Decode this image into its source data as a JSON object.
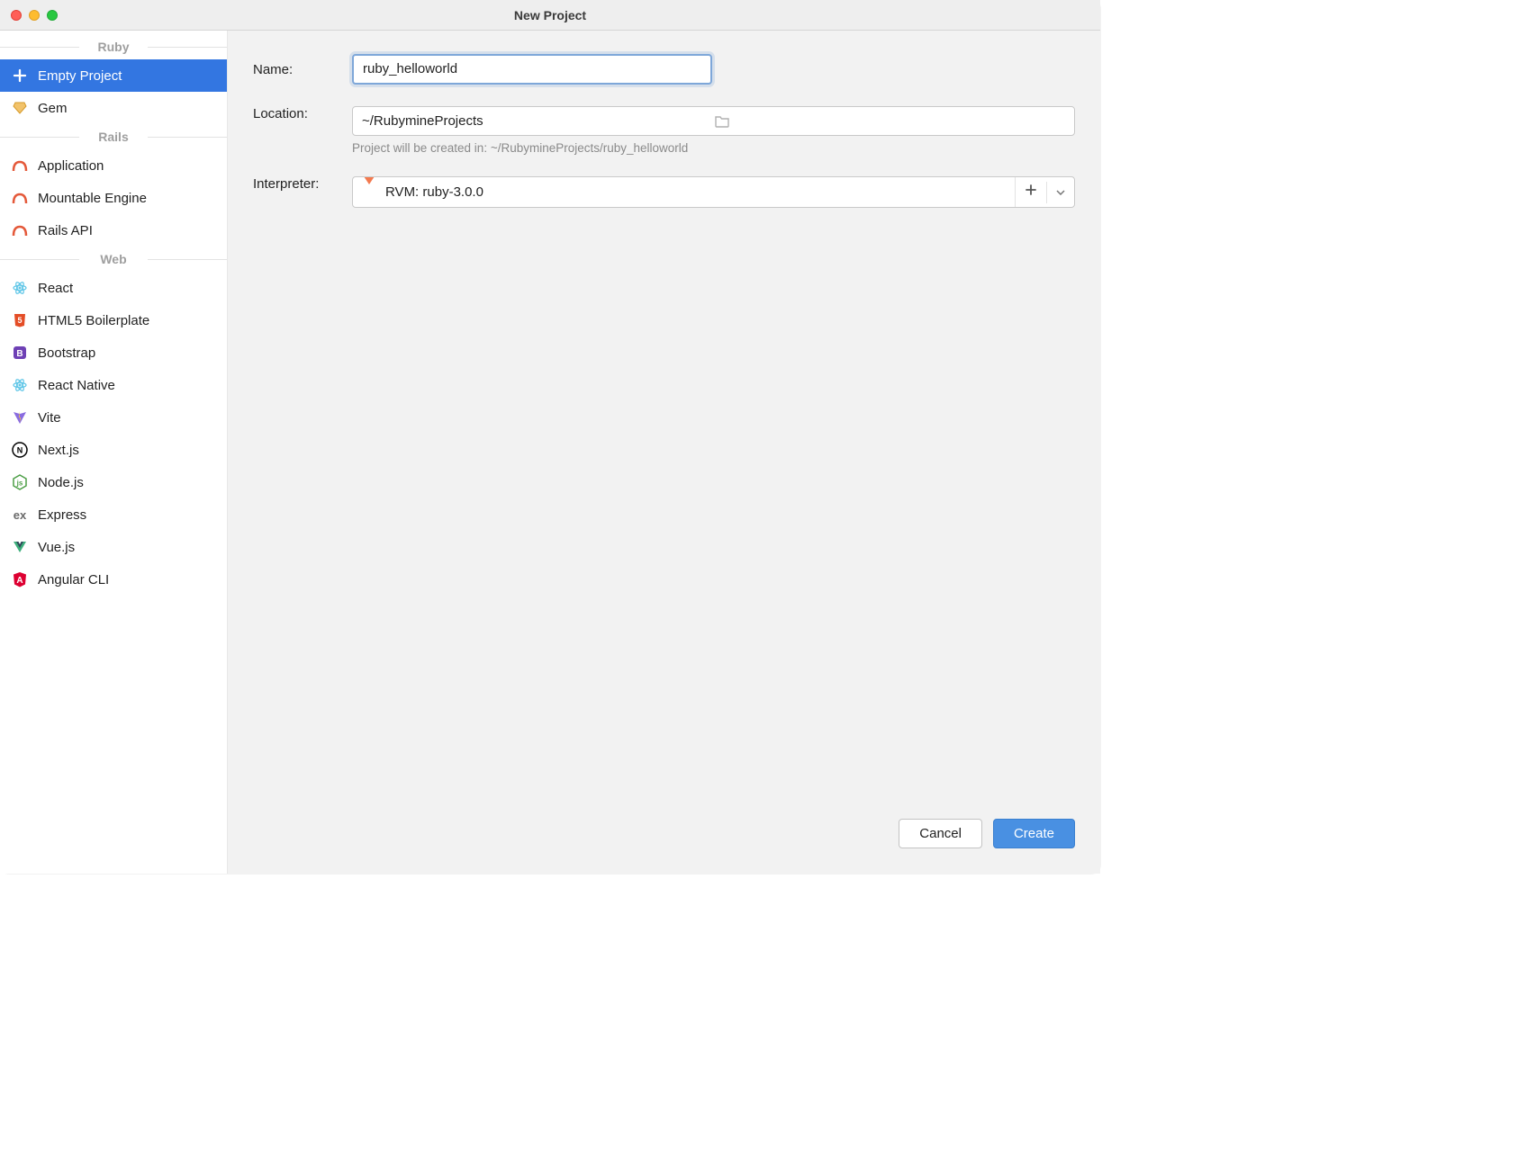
{
  "window": {
    "title": "New Project"
  },
  "sidebar": {
    "categories": [
      {
        "label": "Ruby",
        "items": [
          {
            "label": "Empty Project",
            "icon": "plus-icon",
            "selected": true
          },
          {
            "label": "Gem",
            "icon": "gem-icon"
          }
        ]
      },
      {
        "label": "Rails",
        "items": [
          {
            "label": "Application",
            "icon": "rails-icon"
          },
          {
            "label": "Mountable Engine",
            "icon": "rails-icon"
          },
          {
            "label": "Rails API",
            "icon": "rails-icon"
          }
        ]
      },
      {
        "label": "Web",
        "items": [
          {
            "label": "React",
            "icon": "react-icon"
          },
          {
            "label": "HTML5 Boilerplate",
            "icon": "html5-icon"
          },
          {
            "label": "Bootstrap",
            "icon": "bootstrap-icon"
          },
          {
            "label": "React Native",
            "icon": "react-icon"
          },
          {
            "label": "Vite",
            "icon": "vite-icon"
          },
          {
            "label": "Next.js",
            "icon": "nextjs-icon"
          },
          {
            "label": "Node.js",
            "icon": "nodejs-icon"
          },
          {
            "label": "Express",
            "icon": "express-icon"
          },
          {
            "label": "Vue.js",
            "icon": "vuejs-icon"
          },
          {
            "label": "Angular CLI",
            "icon": "angular-icon"
          }
        ]
      }
    ]
  },
  "form": {
    "name_label": "Name:",
    "name_value": "ruby_helloworld",
    "location_label": "Location:",
    "location_value": "~/RubymineProjects",
    "location_hint": "Project will be created in: ~/RubymineProjects/ruby_helloworld",
    "interpreter_label": "Interpreter:",
    "interpreter_value": "RVM: ruby-3.0.0"
  },
  "footer": {
    "cancel": "Cancel",
    "create": "Create"
  }
}
